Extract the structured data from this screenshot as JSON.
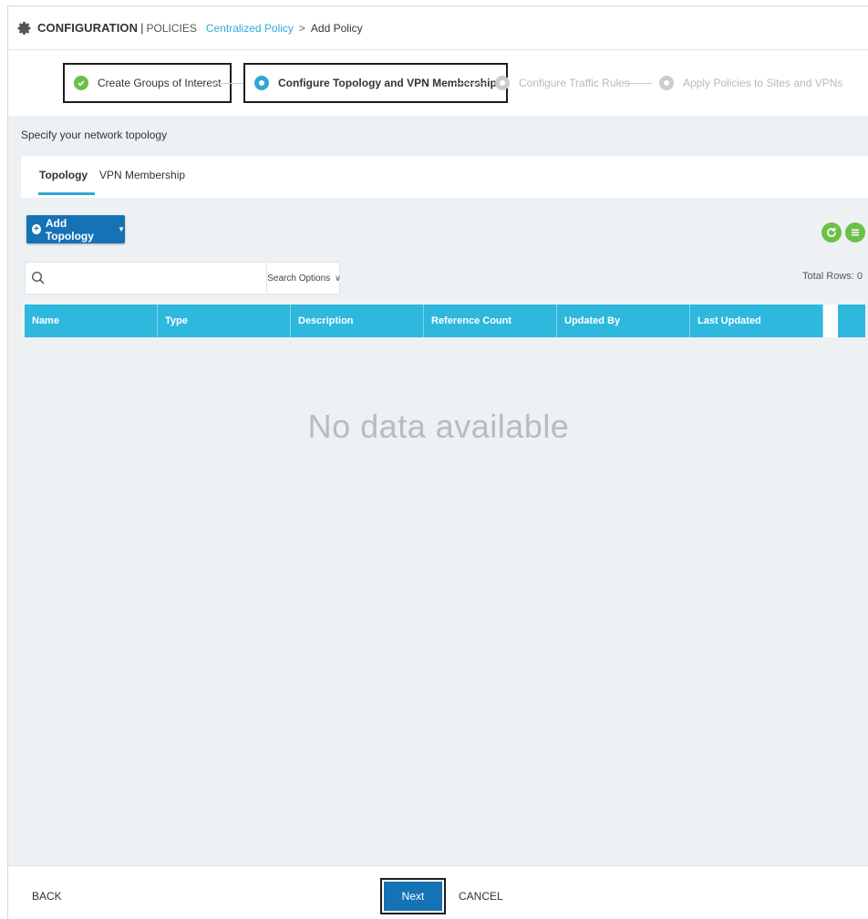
{
  "header": {
    "section": "CONFIGURATION",
    "separator": "|",
    "subsection": "POLICIES",
    "breadcrumb_link": "Centralized Policy",
    "breadcrumb_arrow": ">",
    "breadcrumb_current": "Add Policy"
  },
  "stepper": {
    "steps": [
      {
        "label": "Create Groups of Interest",
        "state": "done"
      },
      {
        "label": "Configure Topology and VPN Membership",
        "state": "active"
      },
      {
        "label": "Configure Traffic Rules",
        "state": "todo"
      },
      {
        "label": "Apply Policies to Sites and VPNs",
        "state": "todo"
      }
    ]
  },
  "section": {
    "title": "Specify your network topology",
    "tabs": [
      {
        "label": "Topology",
        "active": true
      },
      {
        "label": "VPN Membership",
        "active": false
      }
    ]
  },
  "toolbar": {
    "add_label": "Add Topology",
    "search_placeholder": "",
    "search_options_label": "Search Options",
    "total_rows": "Total Rows: 0"
  },
  "table": {
    "columns": [
      "Name",
      "Type",
      "Description",
      "Reference Count",
      "Updated By",
      "Last Updated"
    ],
    "empty_message": "No data available"
  },
  "footer": {
    "back_label": "BACK",
    "next_label": "Next",
    "cancel_label": "CANCEL"
  },
  "colors": {
    "accent": "#2fa8d8",
    "primary_button": "#1573b5",
    "success": "#6cc04a",
    "table_header": "#2eb8de"
  }
}
